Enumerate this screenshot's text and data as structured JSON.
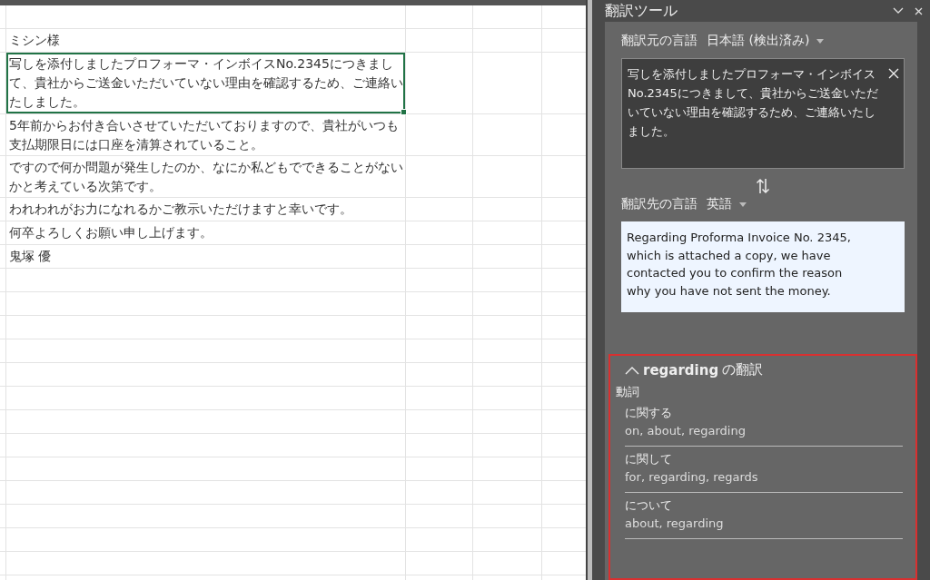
{
  "sheet": {
    "cells": [
      {
        "text": "ミシン様",
        "selected": false
      },
      {
        "text": "写しを添付しましたプロフォーマ・インボイスNo.2345につきまして、貴社からご送金いただいていない理由を確認するため、ご連絡いたしました。",
        "selected": true
      },
      {
        "text": "5年前からお付き合いさせていただいておりますので、貴社がいつも支払期限日には口座を清算されていること。",
        "selected": false
      },
      {
        "text": "ですので何か問題が発生したのか、なにか私どもでできることがないかと考えている次第です。",
        "selected": false
      },
      {
        "text": "われわれがお力になれるかご教示いただけますと幸いです。",
        "selected": false
      },
      {
        "text": "何卒よろしくお願い申し上げます。",
        "selected": false
      },
      {
        "text": "鬼塚 優",
        "selected": false
      }
    ]
  },
  "panel": {
    "title": "翻訳ツール",
    "source_language": {
      "label": "翻訳元の言語",
      "value": "日本語 (検出済み)"
    },
    "source_text": "写しを添付しましたプロフォーマ・インボイスNo.2345につきまして、貴社からご送金いただいていない理由を確認するため、ご連絡いたしました。",
    "target_language": {
      "label": "翻訳先の言語",
      "value": "英語"
    },
    "target_text": "Regarding Proforma Invoice No. 2345, which is attached a copy, we have contacted you to confirm the reason why you have not sent the money.",
    "dictionary": {
      "word": "regarding",
      "heading": "の翻訳",
      "expanded": true,
      "part_of_speech": "動詞",
      "entries": [
        {
          "term": "に関する",
          "meanings": "on, about, regarding"
        },
        {
          "term": "に関して",
          "meanings": "for, regarding, regards"
        },
        {
          "term": "について",
          "meanings": "about, regarding"
        }
      ]
    }
  }
}
